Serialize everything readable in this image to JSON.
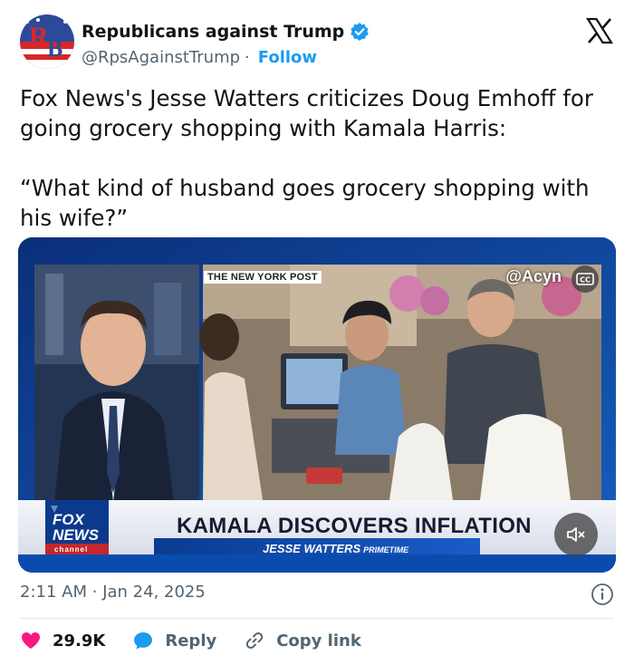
{
  "author": {
    "display_name": "Republicans against Trump",
    "handle": "@RpsAgainstTrump",
    "separator": "·",
    "follow_label": "Follow",
    "avatar_letters": "RB",
    "verified_color": "#1d9bf0"
  },
  "platform": {
    "logo": "x-logo-icon"
  },
  "tweet": {
    "text": "Fox News's Jesse Watters criticizes Doug Emhoff for going grocery shopping with Kamala Harris:\n\n“What kind of husband goes grocery shopping with his wife?”"
  },
  "video": {
    "source_tag": "THE NEW YORK POST",
    "watermark": "@Acyn",
    "cc_label": "CC",
    "network_logo": "FOX NEWS",
    "network_sub": "channel",
    "headline": "KAMALA DISCOVERS INFLATION",
    "show_name": "JESSE WATTERS",
    "show_suffix": "PRIMETIME",
    "mute_icon": "muted-speaker-icon"
  },
  "meta": {
    "time": "2:11 AM",
    "separator": "·",
    "date": "Jan 24, 2025"
  },
  "actions": {
    "like_count": "29.9K",
    "reply_label": "Reply",
    "copy_label": "Copy link"
  },
  "colors": {
    "accent": "#1d9bf0",
    "like": "#f91880",
    "secondary_text": "#536471"
  }
}
